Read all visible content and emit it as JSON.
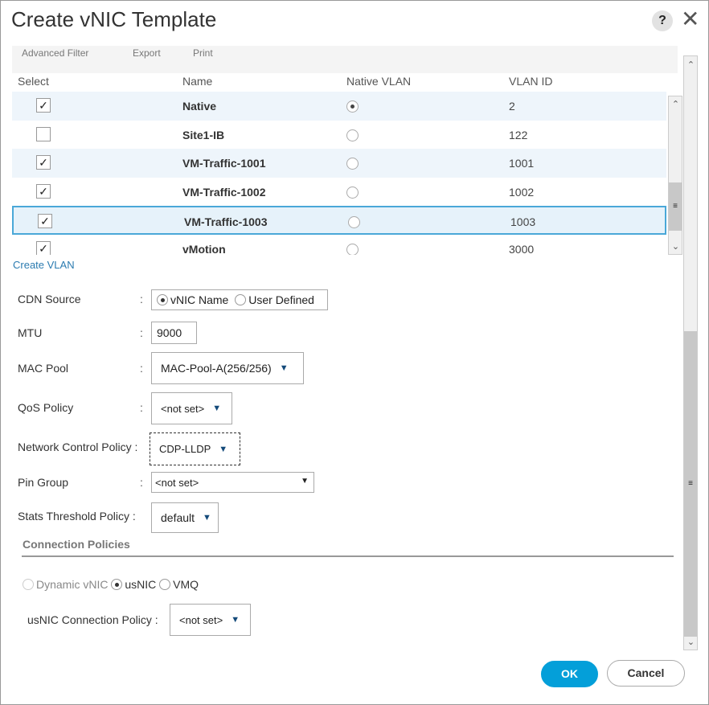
{
  "dialog": {
    "title": "Create vNIC Template",
    "help_label": "?",
    "close_label": "✕"
  },
  "toolbar": {
    "advanced_filter": "Advanced Filter",
    "export": "Export",
    "print": "Print"
  },
  "table": {
    "headers": [
      "Select",
      "Name",
      "Native VLAN",
      "VLAN ID"
    ],
    "rows": [
      {
        "selected": true,
        "name": "Native",
        "native": true,
        "vlan_id": "2"
      },
      {
        "selected": false,
        "name": "Site1-IB",
        "native": false,
        "vlan_id": "122"
      },
      {
        "selected": true,
        "name": "VM-Traffic-1001",
        "native": false,
        "vlan_id": "1001"
      },
      {
        "selected": true,
        "name": "VM-Traffic-1002",
        "native": false,
        "vlan_id": "1002"
      },
      {
        "selected": true,
        "name": "VM-Traffic-1003",
        "native": false,
        "vlan_id": "1003"
      },
      {
        "selected": true,
        "name": "vMotion",
        "native": false,
        "vlan_id": "3000"
      }
    ]
  },
  "create_vlan": "Create VLAN",
  "form": {
    "colon": ":",
    "cdn_source": {
      "label": "CDN Source",
      "opt1": "vNIC Name",
      "opt2": "User Defined"
    },
    "mtu": {
      "label": "MTU",
      "value": "9000"
    },
    "mac_pool": {
      "label": "MAC Pool",
      "value": "MAC-Pool-A(256/256)"
    },
    "qos": {
      "label": "QoS Policy",
      "value": "<not set>"
    },
    "ncp": {
      "label": "Network Control Policy :",
      "value": "CDP-LLDP"
    },
    "pin_group": {
      "label": "Pin Group",
      "value": "<not set>"
    },
    "stats": {
      "label": "Stats Threshold Policy :",
      "value": "default"
    }
  },
  "connection": {
    "title": "Connection Policies",
    "opt1": "Dynamic vNIC",
    "opt2": "usNIC",
    "opt3": "VMQ",
    "usnic_label": "usNIC Connection Policy :",
    "usnic_value": "<not set>"
  },
  "buttons": {
    "ok": "OK",
    "cancel": "Cancel"
  },
  "colors": {
    "accent": "#049fd9",
    "link": "#2b7bb0"
  }
}
